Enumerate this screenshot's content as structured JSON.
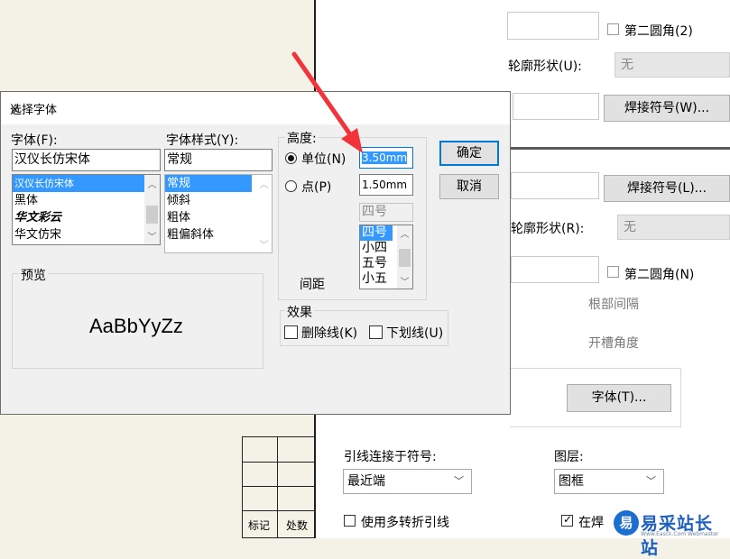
{
  "cad": {
    "cell_labels": [
      "标记",
      "处数"
    ]
  },
  "panel": {
    "second_fillet_1": "第二圆角(2)",
    "outline_shape_u_label": "轮廓形状(U):",
    "outline_shape_u_value": "无",
    "weld_symbol_w_button": "焊接符号(W)...",
    "weld_symbol_l_button": "焊接符号(L)...",
    "outline_shape_r_label": "轮廓形状(R):",
    "outline_shape_r_value": "无",
    "second_fillet_n": "第二圆角(N)",
    "root_spacing_label": "根部间隔",
    "groove_angle_label": "开槽角度",
    "font_button": "字体(T)...",
    "leader_connect_label": "引线连接于符号:",
    "leader_connect_value": "最近端",
    "layer_label": "图层:",
    "layer_value": "图框",
    "multi_bend_label": "使用多转折引线",
    "on_weld_label": "在焊"
  },
  "dialog": {
    "title": "选择字体",
    "font_label": "字体(F):",
    "font_value": "汉仪长仿宋体",
    "font_list": [
      "汉仪长仿宋体",
      "黑体",
      "华文彩云",
      "华文仿宋"
    ],
    "style_label": "字体样式(Y):",
    "style_value": "常规",
    "style_list": [
      "常规",
      "倾斜",
      "粗体",
      "粗偏斜体"
    ],
    "height_group": "高度:",
    "unit_radio": "单位(N)",
    "unit_value": "3.50mm",
    "point_radio": "点(P)",
    "point_value": "1.50mm",
    "size_value": "四号",
    "size_list": [
      "四号",
      "小四",
      "五号",
      "小五"
    ],
    "spacing_label": "间距",
    "ok_button": "确定",
    "cancel_button": "取消",
    "preview_label": "预览",
    "preview_text": "AaBbYyZz",
    "effects_label": "效果",
    "strikeout_label": "删除线(K)",
    "underline_label": "下划线(U)"
  },
  "watermark": {
    "logo_char": "易",
    "site_name": "易采站长站",
    "site_url": "Www.Easck.Com Webmaster"
  },
  "colors": {
    "selection": "#3399ff",
    "default_button_border": "#0078d7",
    "arrow": "#f2343a",
    "watermark_blue": "#1c6fd1"
  }
}
